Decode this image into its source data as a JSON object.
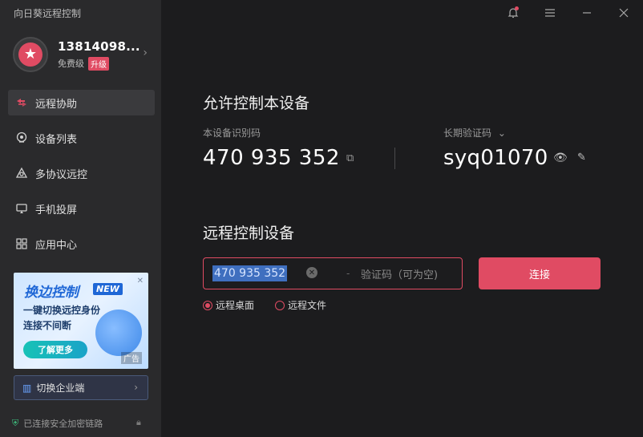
{
  "app": {
    "title": "向日葵远程控制"
  },
  "profile": {
    "username": "13814098...",
    "tier": "免费级",
    "upgrade": "升级"
  },
  "nav": [
    {
      "label": "远程协助",
      "icon": "remote-assist-icon",
      "active": true
    },
    {
      "label": "设备列表",
      "icon": "device-list-icon",
      "active": false
    },
    {
      "label": "多协议远控",
      "icon": "multi-protocol-icon",
      "active": false
    },
    {
      "label": "手机投屏",
      "icon": "screen-cast-icon",
      "active": false
    },
    {
      "label": "应用中心",
      "icon": "app-center-icon",
      "active": false
    }
  ],
  "ad": {
    "title": "换边控制",
    "badge": "NEW",
    "line1": "一键切换远控身份",
    "line2": "连接不间断",
    "button": "了解更多",
    "tag": "广告"
  },
  "sidebar_bottom": {
    "switch_label": "切换企业端",
    "status": "已连接安全加密链路"
  },
  "allow_control": {
    "title": "允许控制本设备",
    "id_label": "本设备识别码",
    "device_id": "470 935 352",
    "code_label": "长期验证码",
    "passcode": "syq01070"
  },
  "remote_control": {
    "title": "远程控制设备",
    "id_value": "470 935 352",
    "code_placeholder": "验证码（可为空)",
    "connect": "连接",
    "options": [
      {
        "label": "远程桌面",
        "checked": true
      },
      {
        "label": "远程文件",
        "checked": false
      }
    ]
  },
  "colors": {
    "accent": "#e04b63",
    "sidebar": "#2a2a2c",
    "main": "#1c1c1e"
  }
}
